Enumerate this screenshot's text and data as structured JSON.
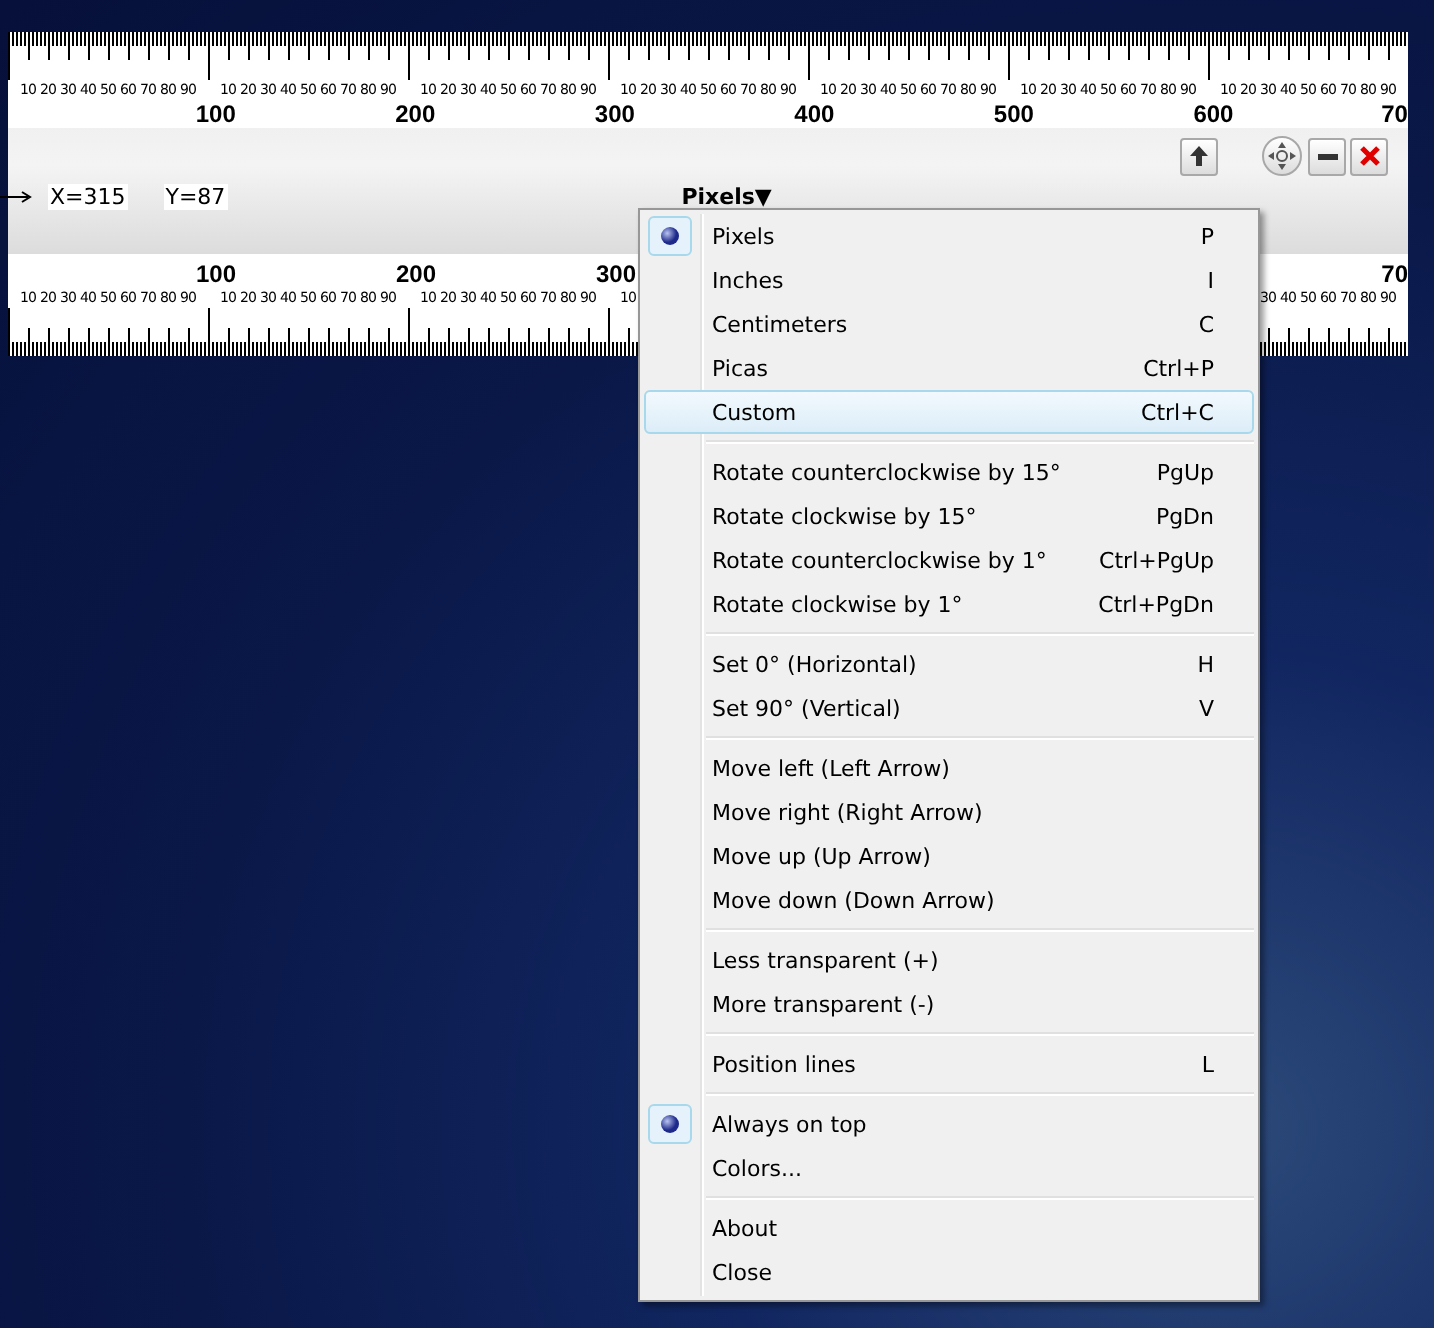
{
  "ruler": {
    "top_scale": {
      "segments": [
        {
          "major": "100",
          "minors": [
            "10",
            "20",
            "30",
            "40",
            "50",
            "60",
            "70",
            "80",
            "90"
          ]
        },
        {
          "major": "200",
          "minors": [
            "10",
            "20",
            "30",
            "40",
            "50",
            "60",
            "70",
            "80",
            "90"
          ]
        },
        {
          "major": "300",
          "minors": [
            "10",
            "20",
            "30",
            "40",
            "50",
            "60",
            "70",
            "80",
            "90"
          ]
        },
        {
          "major": "400",
          "minors": [
            "10",
            "20",
            "30",
            "40",
            "50",
            "60",
            "70",
            "80",
            "90"
          ]
        },
        {
          "major": "500",
          "minors": [
            "10",
            "20",
            "30",
            "40",
            "50",
            "60",
            "70",
            "80",
            "90"
          ]
        },
        {
          "major": "600",
          "minors": [
            "10",
            "20",
            "30",
            "40",
            "50",
            "60",
            "70",
            "80",
            "90"
          ]
        },
        {
          "major": "70",
          "minors": [
            "10",
            "20",
            "30",
            "40",
            "50",
            "60",
            "70",
            "80",
            "90"
          ]
        }
      ]
    },
    "coordinates": {
      "x": "X=315",
      "y": "Y=87"
    },
    "unit_dropdown": {
      "label": "Pixels▼"
    },
    "bottom_scale": {
      "segments": [
        {
          "major": "100",
          "minors": [
            "10",
            "20",
            "30",
            "40",
            "50",
            "60",
            "70",
            "80",
            "90"
          ]
        },
        {
          "major": "200",
          "minors": [
            "10",
            "20",
            "30",
            "40",
            "50",
            "60",
            "70",
            "80",
            "90"
          ]
        },
        {
          "major": "300",
          "minors": [
            "10",
            "20",
            "30",
            "40",
            "50",
            "60",
            "70",
            "80",
            "90"
          ]
        },
        {
          "leading_hidden": false,
          "minors": [
            "10"
          ]
        },
        {
          "leading_hidden": true,
          "major": "70",
          "minors": [
            "30",
            "40",
            "50",
            "60",
            "70",
            "80",
            "90"
          ]
        }
      ]
    }
  },
  "menu": {
    "items": [
      {
        "kind": "item",
        "label": "Pixels",
        "shortcut": "P",
        "checked": true,
        "highlighted": false
      },
      {
        "kind": "item",
        "label": "Inches",
        "shortcut": "I",
        "checked": false,
        "highlighted": false
      },
      {
        "kind": "item",
        "label": "Centimeters",
        "shortcut": "C",
        "checked": false,
        "highlighted": false
      },
      {
        "kind": "item",
        "label": "Picas",
        "shortcut": "Ctrl+P",
        "checked": false,
        "highlighted": false
      },
      {
        "kind": "item",
        "label": "Custom",
        "shortcut": "Ctrl+C",
        "checked": false,
        "highlighted": true
      },
      {
        "kind": "separator"
      },
      {
        "kind": "item",
        "label": "Rotate counterclockwise by 15°",
        "shortcut": "PgUp",
        "checked": false,
        "highlighted": false
      },
      {
        "kind": "item",
        "label": "Rotate clockwise by 15°",
        "shortcut": "PgDn",
        "checked": false,
        "highlighted": false
      },
      {
        "kind": "item",
        "label": "Rotate counterclockwise by 1°",
        "shortcut": "Ctrl+PgUp",
        "checked": false,
        "highlighted": false
      },
      {
        "kind": "item",
        "label": "Rotate clockwise by 1°",
        "shortcut": "Ctrl+PgDn",
        "checked": false,
        "highlighted": false
      },
      {
        "kind": "separator"
      },
      {
        "kind": "item",
        "label": "Set 0° (Horizontal)",
        "shortcut": "H",
        "checked": false,
        "highlighted": false
      },
      {
        "kind": "item",
        "label": "Set 90° (Vertical)",
        "shortcut": "V",
        "checked": false,
        "highlighted": false
      },
      {
        "kind": "separator"
      },
      {
        "kind": "item",
        "label": "Move left (Left Arrow)",
        "checked": false,
        "highlighted": false
      },
      {
        "kind": "item",
        "label": "Move right (Right Arrow)",
        "checked": false,
        "highlighted": false
      },
      {
        "kind": "item",
        "label": "Move up (Up Arrow)",
        "checked": false,
        "highlighted": false
      },
      {
        "kind": "item",
        "label": "Move down (Down Arrow)",
        "checked": false,
        "highlighted": false
      },
      {
        "kind": "separator"
      },
      {
        "kind": "item",
        "label": "Less transparent (+)",
        "checked": false,
        "highlighted": false
      },
      {
        "kind": "item",
        "label": "More transparent (-)",
        "checked": false,
        "highlighted": false
      },
      {
        "kind": "separator"
      },
      {
        "kind": "item",
        "label": "Position lines",
        "shortcut": "L",
        "checked": false,
        "highlighted": false
      },
      {
        "kind": "separator"
      },
      {
        "kind": "item",
        "label": "Always on top",
        "checked": true,
        "highlighted": false
      },
      {
        "kind": "item",
        "label": "Colors...",
        "checked": false,
        "highlighted": false
      },
      {
        "kind": "separator"
      },
      {
        "kind": "item",
        "label": "About",
        "checked": false,
        "highlighted": false
      },
      {
        "kind": "item",
        "label": "Close",
        "checked": false,
        "highlighted": false
      }
    ]
  }
}
